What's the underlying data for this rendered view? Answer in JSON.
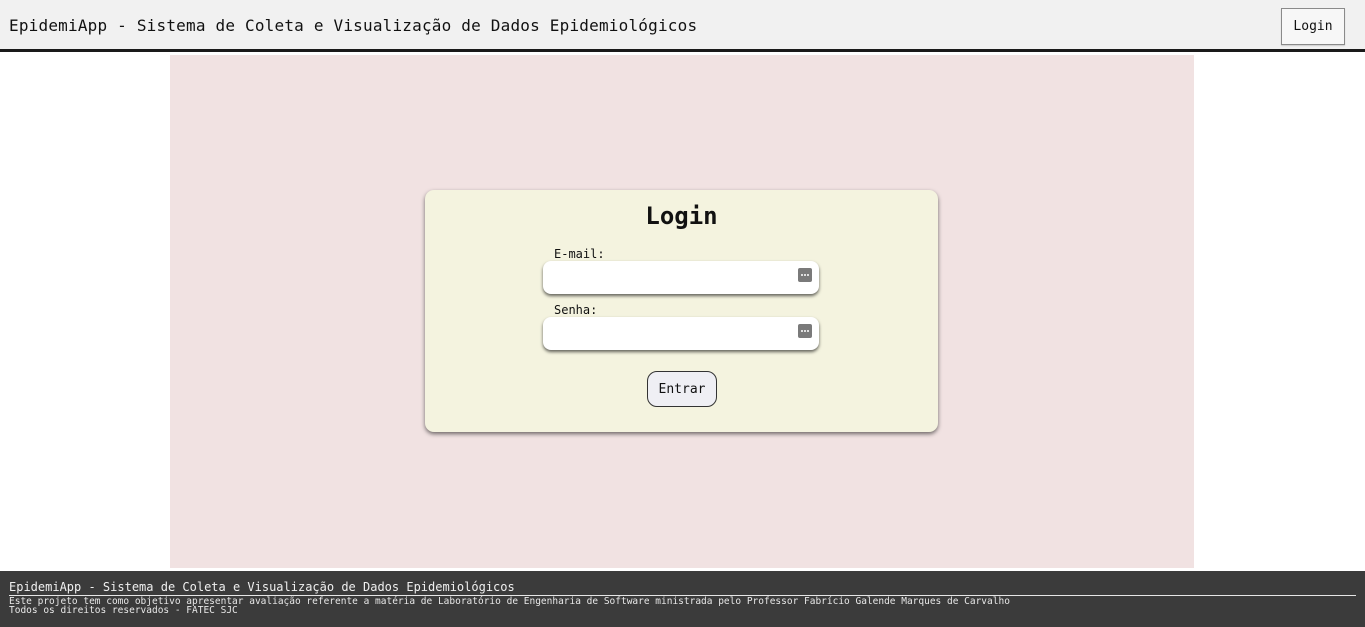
{
  "header": {
    "title": "EpidemiApp - Sistema de Coleta e Visualização de Dados Epidemiológicos",
    "login_button": "Login"
  },
  "login_form": {
    "title": "Login",
    "email_label": "E-mail:",
    "email_value": "",
    "password_label": "Senha:",
    "password_value": "",
    "submit_label": "Entrar",
    "field_icon": "password-manager-icon"
  },
  "footer": {
    "title": "EpidemiApp - Sistema de Coleta e Visualização de Dados Epidemiológicos",
    "description": "Este projeto tem como objetivo apresentar avaliação referente a matéria de Laboratório de Engenharia de Software ministrada pelo Professor Fabrício Galende Marques de Carvalho",
    "rights": "Todos os direitos reservados - FATEC SJC"
  },
  "colors": {
    "header_bg": "#f1f1f1",
    "main_bg": "#f1e2e2",
    "card_bg": "#f4f3df",
    "footer_bg": "#3b3b3b"
  }
}
